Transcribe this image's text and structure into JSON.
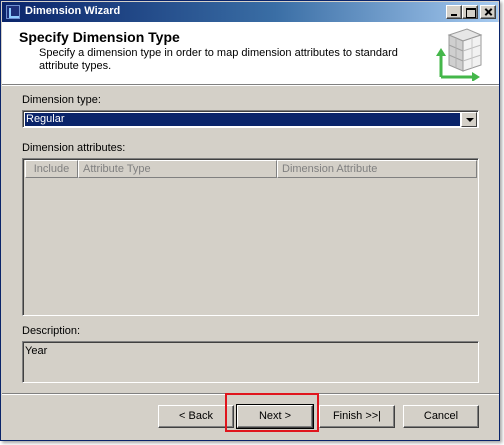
{
  "window": {
    "title": "Dimension Wizard"
  },
  "header": {
    "title": "Specify Dimension Type",
    "description": "Specify a dimension type in order to map dimension attributes to standard attribute types."
  },
  "form": {
    "dimension_type_label": "Dimension type:",
    "dimension_type_value": "Regular",
    "dimension_attributes_label": "Dimension attributes:",
    "columns": [
      "Include",
      "Attribute Type",
      "Dimension Attribute"
    ],
    "description_label": "Description:",
    "description_value": "Year"
  },
  "buttons": {
    "back": "< Back",
    "next": "Next >",
    "finish": "Finish >>|",
    "cancel": "Cancel"
  },
  "icons": {
    "title_icon": "wizard-app-icon",
    "header_graphic": "dimension-cube-icon"
  },
  "colors": {
    "title_bar": "#0a246a",
    "selection": "#0a246a",
    "highlight": "#e0151d",
    "face": "#d4d0c8"
  }
}
